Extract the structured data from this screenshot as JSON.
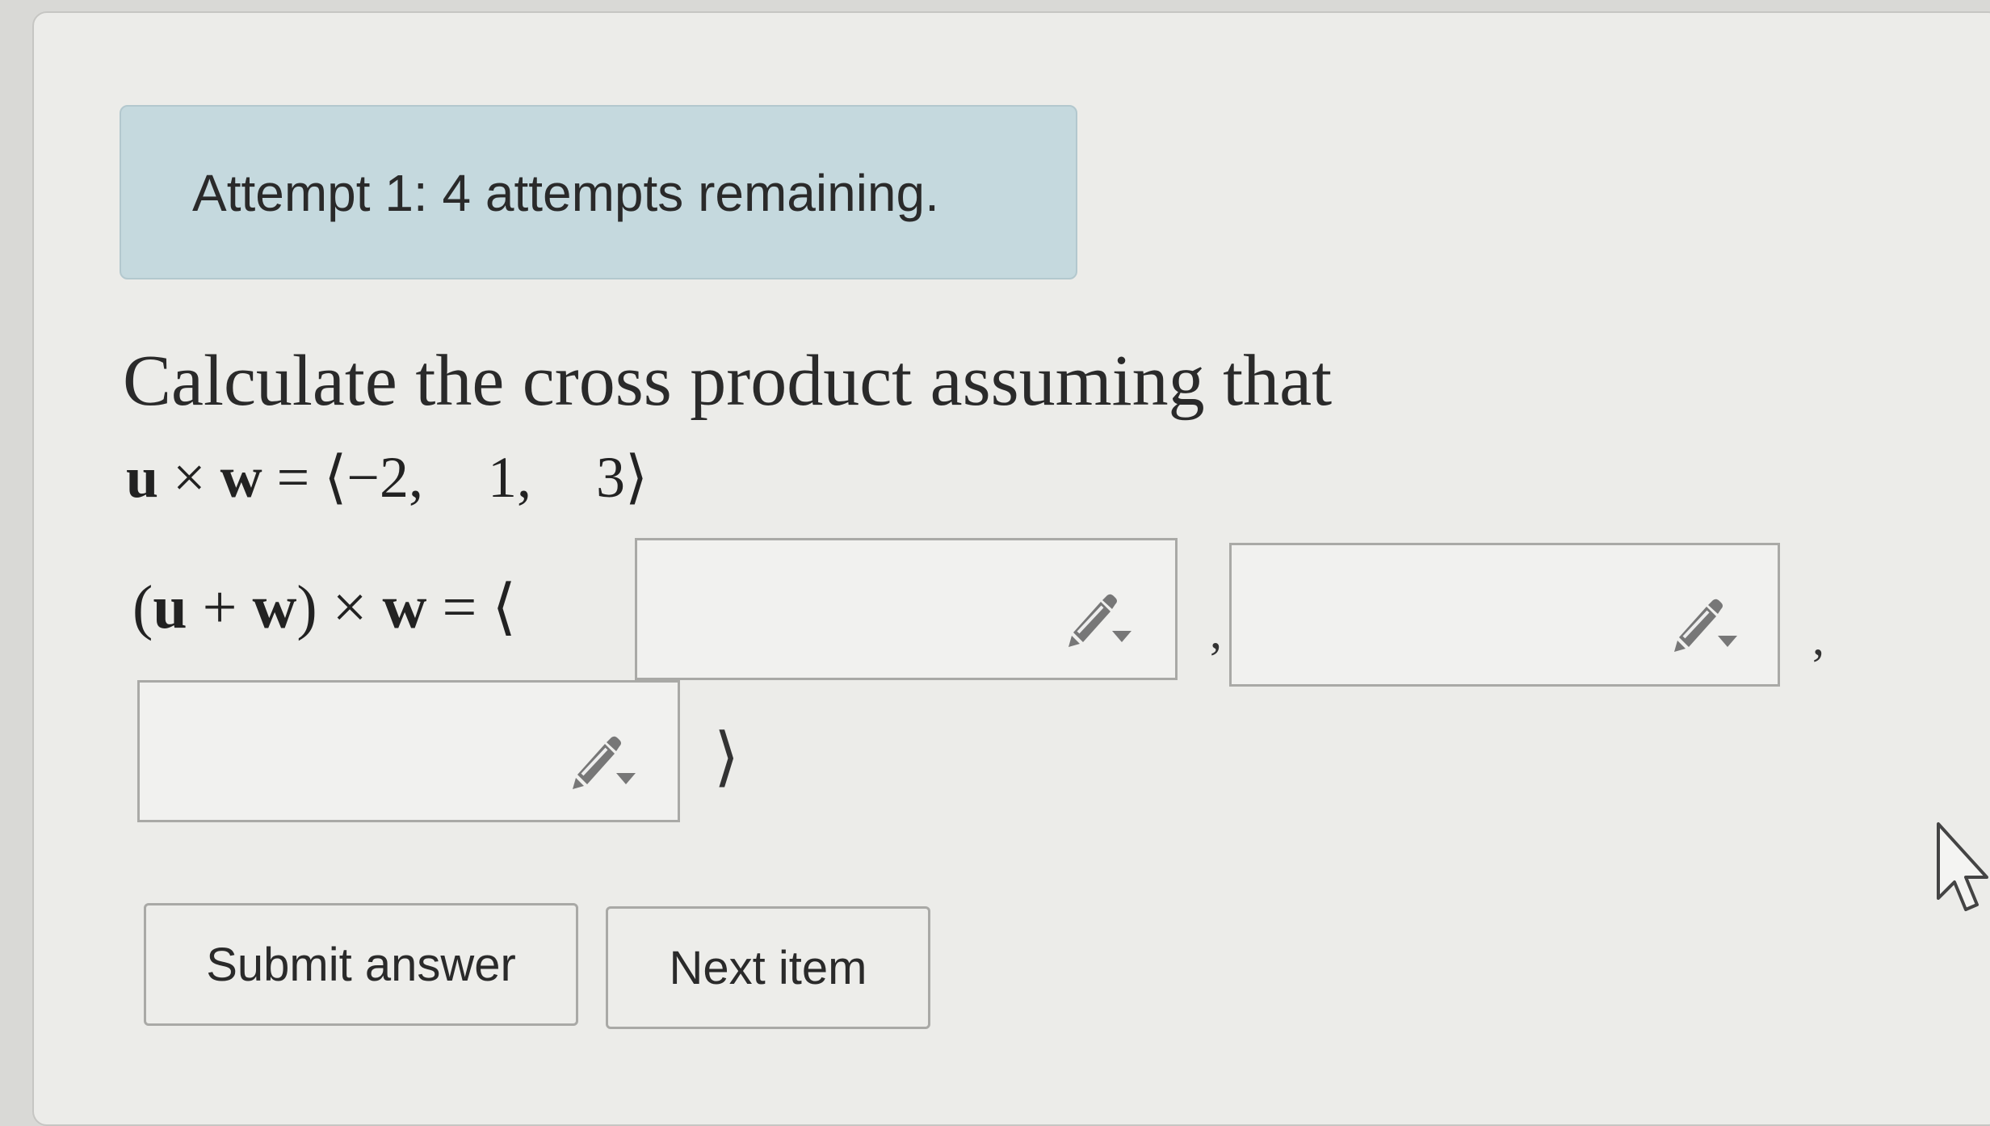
{
  "attempt": {
    "text": "Attempt 1: 4 attempts remaining."
  },
  "question": {
    "prompt": "Calculate the cross product assuming that",
    "given": {
      "lhs_u": "u",
      "times": "×",
      "lhs_w": "w",
      "equals": "=",
      "langle": "⟨",
      "x": "−2,",
      "y": "1,",
      "z": "3",
      "rangle": "⟩"
    },
    "target": {
      "open_paren": "(",
      "u": "u",
      "plus": "+",
      "w1": "w",
      "close_paren": ")",
      "times": "×",
      "w2": "w",
      "equals": "=",
      "langle": "⟨"
    },
    "answers": [
      {
        "value": "",
        "placeholder": ""
      },
      {
        "value": "",
        "placeholder": ""
      },
      {
        "value": "",
        "placeholder": ""
      }
    ],
    "comma": ",",
    "rangle": "⟩"
  },
  "buttons": {
    "submit": "Submit answer",
    "next": "Next item"
  },
  "icons": {
    "answer_tool": "pencil-dropdown-icon",
    "cursor": "mouse-pointer-icon"
  },
  "colors": {
    "banner_bg": "#c5d9de",
    "panel_bg": "#ecece9",
    "pencil": "#777777"
  }
}
